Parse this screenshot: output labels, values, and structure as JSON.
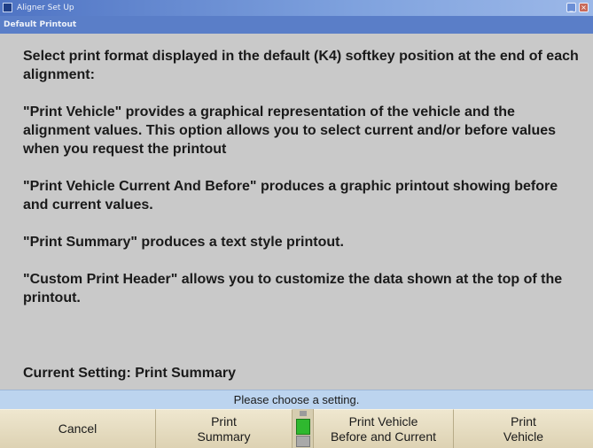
{
  "window": {
    "title": "Aligner Set Up",
    "subtitle": "Default Printout"
  },
  "content": {
    "paragraphs": [
      "Select print format displayed in the default (K4) softkey position at the end of each alignment:",
      "\"Print Vehicle\" provides a graphical representation of the vehicle and the alignment values.  This option allows you to select current and/or before values when you request the printout",
      "\"Print Vehicle Current And Before\" produces a graphic printout showing before and current values.",
      "\"Print Summary\" produces a text style printout.",
      "\"Custom Print Header\" allows you to customize the data shown at the top of the printout."
    ],
    "current_setting": "Current Setting: Print Summary"
  },
  "status": {
    "message": "Please choose a setting."
  },
  "softkeys": {
    "k1": "Cancel",
    "k2": "Print\nSummary",
    "k3": "Print Vehicle\nBefore and Current",
    "k4": "Print\nVehicle"
  },
  "icons": {
    "app": "app-icon",
    "minimize": "minimize-icon",
    "close": "close-icon",
    "indicator": "page-indicator-icon"
  },
  "colors": {
    "background": "#c9c9c9",
    "titlebar": "#4f74c4",
    "statusbar": "#bcd4ef",
    "softkey": "#e5dcc0",
    "indicator_green": "#2fb82f"
  }
}
